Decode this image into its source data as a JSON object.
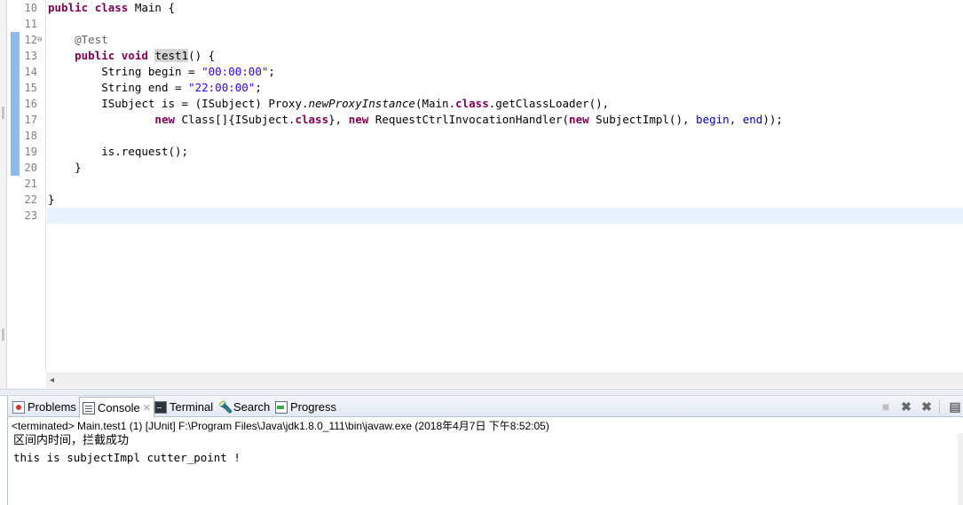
{
  "editor": {
    "line_numbers": [
      "10",
      "11",
      "12",
      "13",
      "14",
      "15",
      "16",
      "17",
      "18",
      "19",
      "20",
      "21",
      "22",
      "23"
    ],
    "fold_marker": "⊖",
    "lines": {
      "l10": {
        "kw1": "public",
        "kw2": "class",
        "rest": " Main {"
      },
      "l12": {
        "annotation": "@Test"
      },
      "l13": {
        "kw1": "public",
        "kw2": "void",
        "method": "test1",
        "rest": "() {"
      },
      "l14": {
        "type": "String begin = ",
        "value": "\"00:00:00\"",
        "end": ";"
      },
      "l15": {
        "type": "String end = ",
        "value": "\"22:00:00\"",
        "end": ";"
      },
      "l16": {
        "p1": "ISubject ",
        "var": "is",
        "p2": " = (ISubject) Proxy.",
        "static_call": "newProxyInstance",
        "p3": "(Main.",
        "kw": "class",
        "p4": ".getClassLoader(),"
      },
      "l17": {
        "kw_new1": "new",
        "p1": " Class[]{ISubject.",
        "kw_class": "class",
        "p2": "}, ",
        "kw_new2": "new",
        "p3": " RequestCtrlInvocationHandler(",
        "kw_new3": "new",
        "p4": " SubjectImpl(), ",
        "f1": "begin",
        "p5": ", ",
        "f2": "end",
        "p6": "));"
      },
      "l19": {
        "var": "is",
        "rest": ".request();"
      },
      "l20": "}",
      "l22": "}"
    },
    "hscroll_left": "◂"
  },
  "console": {
    "tabs": {
      "problems": "Problems",
      "console": "Console",
      "console_close": "✕",
      "terminal": "Terminal",
      "search": "Search",
      "progress": "Progress"
    },
    "icons": {
      "search": "🔦"
    },
    "toolbar": {
      "stop": "■",
      "remove": "✖",
      "remove_all": "✖",
      "clear": "▤"
    },
    "header": "<terminated> Main.test1 (1) [JUnit] F:\\Program Files\\Java\\jdk1.8.0_111\\bin\\javaw.exe (2018年4月7日 下午8:52:05)",
    "output_line1": "区间内时间，拦截成功",
    "output_line2": "this is subjectImpl cutter_point !"
  }
}
